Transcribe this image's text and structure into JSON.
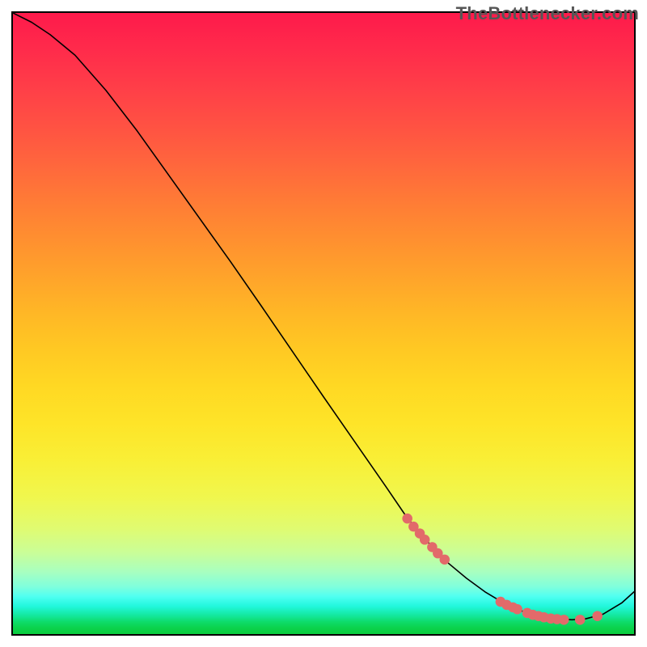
{
  "watermark": "TheBottlenecker.com",
  "chart_data": {
    "type": "line",
    "title": "",
    "xlabel": "",
    "ylabel": "",
    "xlim": [
      0,
      100
    ],
    "ylim": [
      0,
      100
    ],
    "series": [
      {
        "name": "bottleneck-curve",
        "x": [
          0,
          3,
          6,
          10,
          15,
          20,
          25,
          30,
          35,
          40,
          45,
          50,
          55,
          60,
          63,
          65,
          68,
          70,
          73,
          76,
          80,
          84,
          88,
          90,
          92,
          95,
          98,
          100
        ],
        "y": [
          100,
          98.5,
          96.5,
          93.2,
          87.5,
          81.0,
          74.0,
          67.0,
          60.0,
          52.8,
          45.5,
          38.2,
          31.0,
          23.8,
          19.4,
          16.8,
          13.5,
          11.5,
          9.0,
          6.8,
          4.4,
          3.0,
          2.4,
          2.3,
          2.4,
          3.2,
          5.0,
          6.8
        ]
      }
    ],
    "points": {
      "name": "highlighted-points",
      "coords": [
        [
          63.5,
          18.6
        ],
        [
          64.5,
          17.3
        ],
        [
          65.5,
          16.2
        ],
        [
          66.3,
          15.2
        ],
        [
          67.5,
          14.0
        ],
        [
          68.4,
          13.0
        ],
        [
          69.5,
          12.0
        ],
        [
          78.5,
          5.2
        ],
        [
          79.5,
          4.7
        ],
        [
          80.5,
          4.3
        ],
        [
          81.2,
          4.0
        ],
        [
          82.8,
          3.4
        ],
        [
          83.7,
          3.1
        ],
        [
          84.6,
          2.9
        ],
        [
          85.5,
          2.7
        ],
        [
          86.6,
          2.5
        ],
        [
          87.6,
          2.4
        ],
        [
          88.7,
          2.3
        ],
        [
          91.3,
          2.3
        ],
        [
          94.1,
          2.9
        ]
      ]
    },
    "point_radius": 6.3,
    "background": "rainbow-vertical"
  }
}
